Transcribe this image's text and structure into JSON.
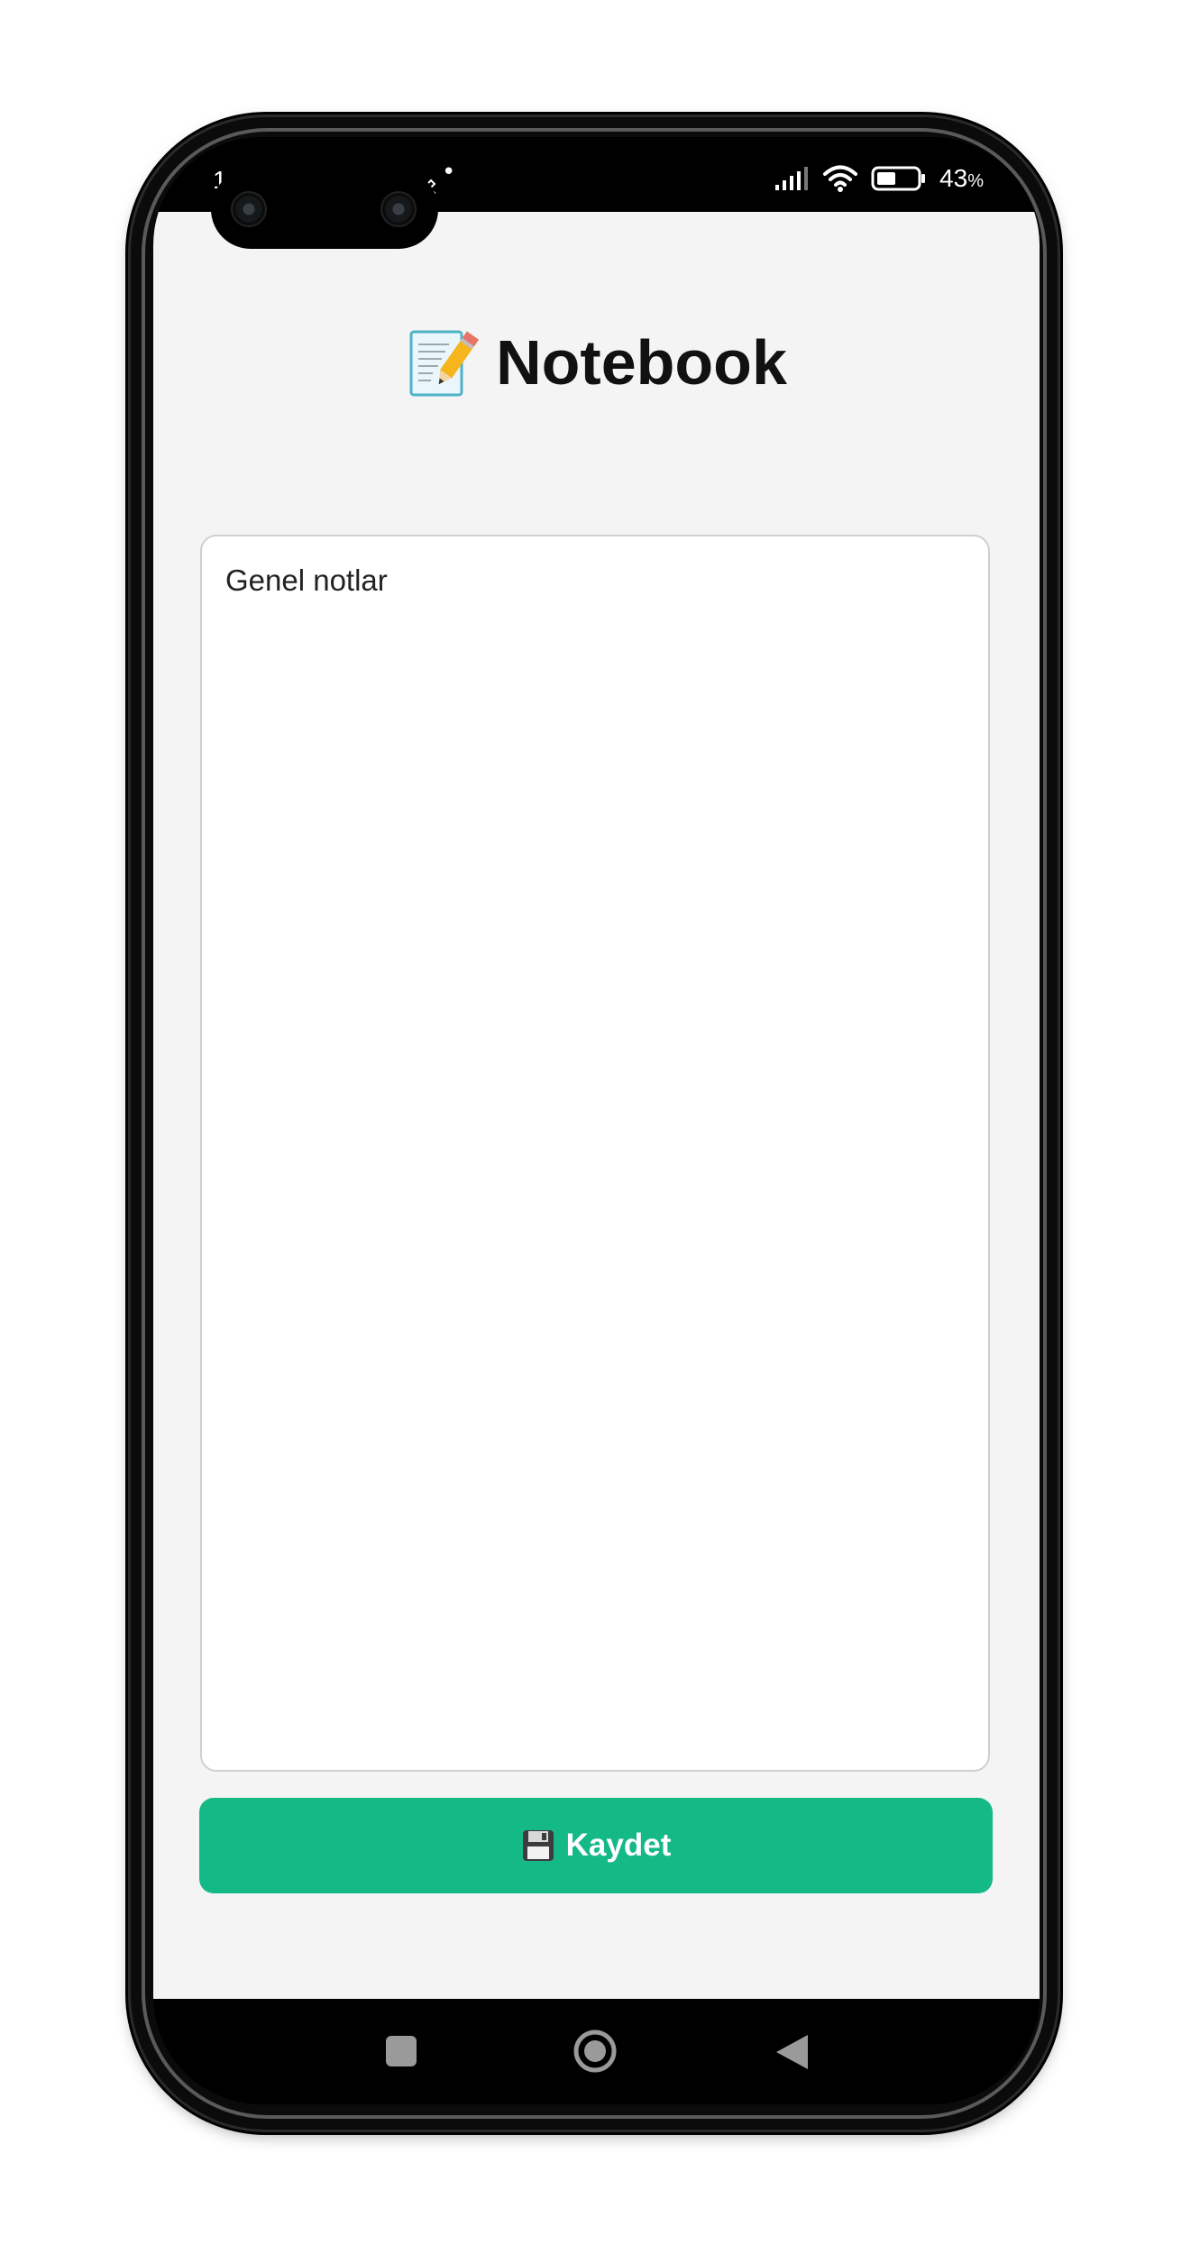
{
  "status_bar": {
    "time_partial": "1",
    "notification_dot": "•",
    "battery_percent": "43",
    "battery_percent_sign": "%",
    "icons": [
      "signal-icon",
      "wifi-icon",
      "battery-icon"
    ]
  },
  "app": {
    "title": "Notebook",
    "title_icon": "memo-pencil-icon",
    "note": {
      "value": "Genel notlar"
    },
    "save_button": {
      "label": "Kaydet",
      "icon": "floppy-disk-icon",
      "color": "#14b985"
    },
    "background": "#f4f4f4"
  },
  "nav_bar": {
    "buttons": [
      "recents-button",
      "home-button",
      "back-button"
    ]
  }
}
